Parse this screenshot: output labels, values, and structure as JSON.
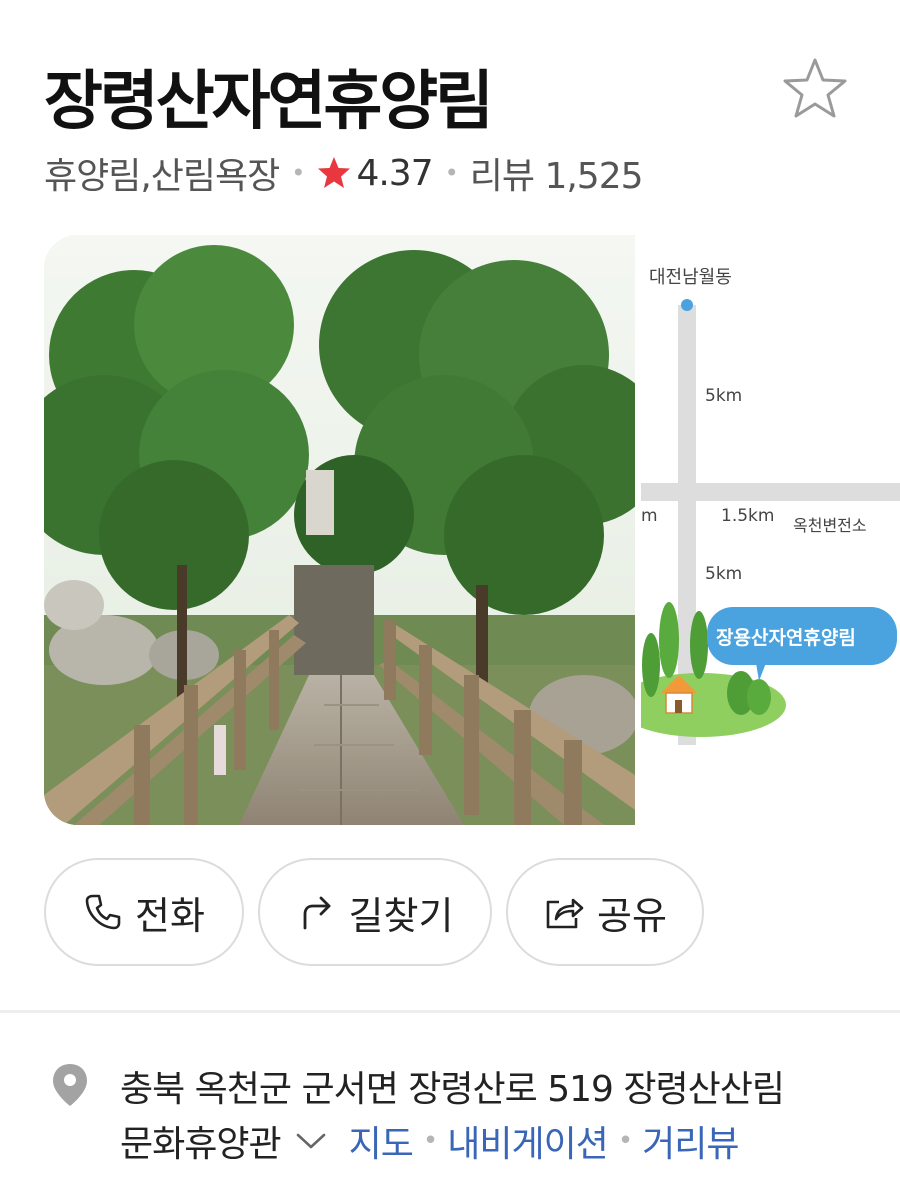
{
  "place": {
    "title": "장령산자연휴양림",
    "category": "휴양림,산림욕장",
    "rating": "4.37",
    "review_label": "리뷰 1,525"
  },
  "icons": {
    "favorite": "star-outline-icon",
    "rating_star": "star-filled-icon",
    "call": "phone-icon",
    "directions": "turn-arrow-icon",
    "share": "share-icon",
    "location": "location-pin-icon",
    "expand": "chevron-down-icon"
  },
  "colors": {
    "rating_star": "#e8373f",
    "link": "#3a66b8",
    "map_bubble": "#4aa3df"
  },
  "map_thumbnail": {
    "top_label": "대전남월동",
    "dist_upper": "5km",
    "dist_mid": "1.5km",
    "right_label": "옥천변전소",
    "dist_lower": "5km",
    "left_fragment": "m",
    "destination": "장용산자연휴양림"
  },
  "actions": {
    "call": "전화",
    "directions": "길찾기",
    "share": "공유"
  },
  "address": {
    "line1": "충북 옥천군 군서면 장령산로 519 장령산산림",
    "line2": "문화휴양관",
    "map_link": "지도",
    "nav_link": "내비게이션",
    "street_link": "거리뷰"
  }
}
